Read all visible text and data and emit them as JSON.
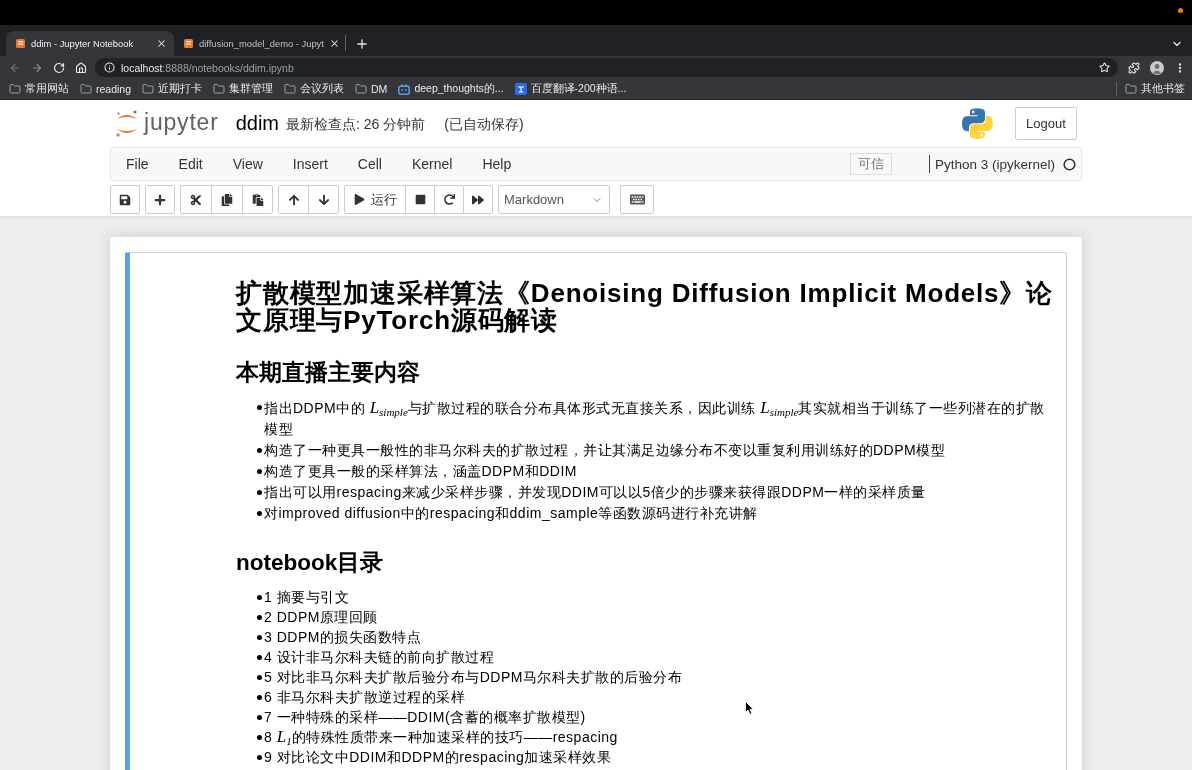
{
  "browser": {
    "tabs": [
      {
        "title": "ddim - Jupyter Notebook",
        "selected": true
      },
      {
        "title": "diffusion_model_demo - Jupyt",
        "selected": false
      }
    ],
    "address": {
      "host": "localhost",
      "path": ":8888/notebooks/ddim.ipynb"
    },
    "bookmarks": [
      {
        "label": "常用网站",
        "kind": "folder"
      },
      {
        "label": "reading",
        "kind": "folder"
      },
      {
        "label": "近期打卡",
        "kind": "folder"
      },
      {
        "label": "集群管理",
        "kind": "folder"
      },
      {
        "label": "会议列表",
        "kind": "folder"
      },
      {
        "label": "DM",
        "kind": "folder"
      },
      {
        "label": "deep_thoughts的...",
        "kind": "site"
      },
      {
        "label": "百度翻译-200种语...",
        "kind": "app"
      }
    ],
    "other_bookmarks": "其他书签"
  },
  "header": {
    "logo_text": "jupyter",
    "notebook_name": "ddim",
    "checkpoint": "最新检查点: 26 分钟前",
    "autosave": "(已自动保存)",
    "logout": "Logout"
  },
  "menu": {
    "items": [
      "File",
      "Edit",
      "View",
      "Insert",
      "Cell",
      "Kernel",
      "Help"
    ],
    "trusted": "可信",
    "kernel": "Python 3 (ipykernel)",
    "kernel_busy": false
  },
  "toolbar": {
    "run_label": "运行",
    "cell_type": "Markdown"
  },
  "cell": {
    "selected": true,
    "title": "扩散模型加速采样算法《Denoising Diffusion Implicit Models》论文原理与PyTorch源码解读",
    "sections": [
      {
        "heading": "本期直播主要内容",
        "items": [
          "指出DDPM中的 *L*$_{simple}$与扩散过程的联合分布具体形式无直接关系，因此训练 *L*$_{simple}$其实就相当于训练了一些列潜在的扩散模型",
          "构造了一种更具一般性的非马尔科夫的扩散过程，并让其满足边缘分布不变以重复利用训练好的DDPM模型",
          "构造了更具一般的采样算法，涵盖DDPM和DDIM",
          "指出可以用respacing来减少采样步骤，并发现DDIM可以以5倍少的步骤来获得跟DDPM一样的采样质量",
          "对improved diffusion中的respacing和ddim_sample等函数源码进行补充讲解"
        ]
      },
      {
        "heading": "notebook目录",
        "items": [
          "1 摘要与引文",
          "2 DDPM原理回顾",
          "3 DDPM的损失函数特点",
          "4 设计非马尔科夫链的前向扩散过程",
          "5 对比非马尔科夫扩散后验分布与DDPM马尔科夫扩散的后验分布",
          "6 非马尔科夫扩散逆过程的采样",
          "7 一种特殊的采样——DDIM(含蓄的概率扩散模型)",
          "8 *L*$_{1}$的特殊性质带来一种加速采样的技巧——respacing",
          "9 对比论文中DDIM和DDPM的respacing加速采样效果"
        ]
      }
    ]
  }
}
